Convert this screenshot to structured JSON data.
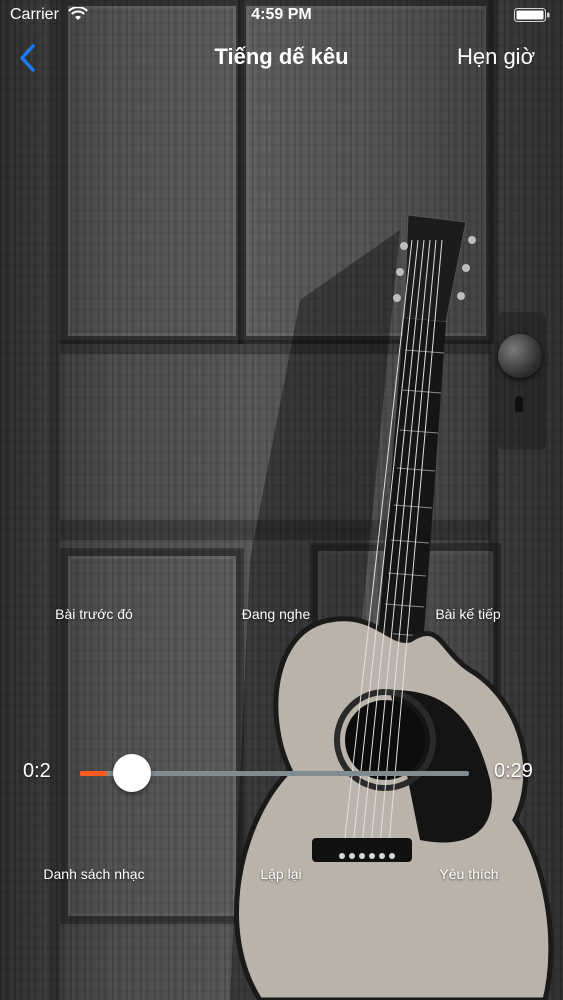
{
  "status_bar": {
    "carrier": "Carrier",
    "time": "4:59 PM"
  },
  "nav": {
    "title": "Tiếng dế kêu",
    "timer_label": "Hẹn giờ",
    "back_icon": "chevron-left-icon",
    "accent_color": "#1a7cf2"
  },
  "controls": {
    "previous_label": "Bài trước đó",
    "now_playing_label": "Đang nghe",
    "next_label": "Bài kế tiếp",
    "playlist_label": "Danh sách nhạc",
    "repeat_label": "Lặp lại",
    "favorite_label": "Yêu thích"
  },
  "player": {
    "elapsed": "0:2",
    "duration": "0:29",
    "progress": 0.069,
    "progress_color": "#ff5a1f",
    "track_color": "#7f8c91"
  }
}
